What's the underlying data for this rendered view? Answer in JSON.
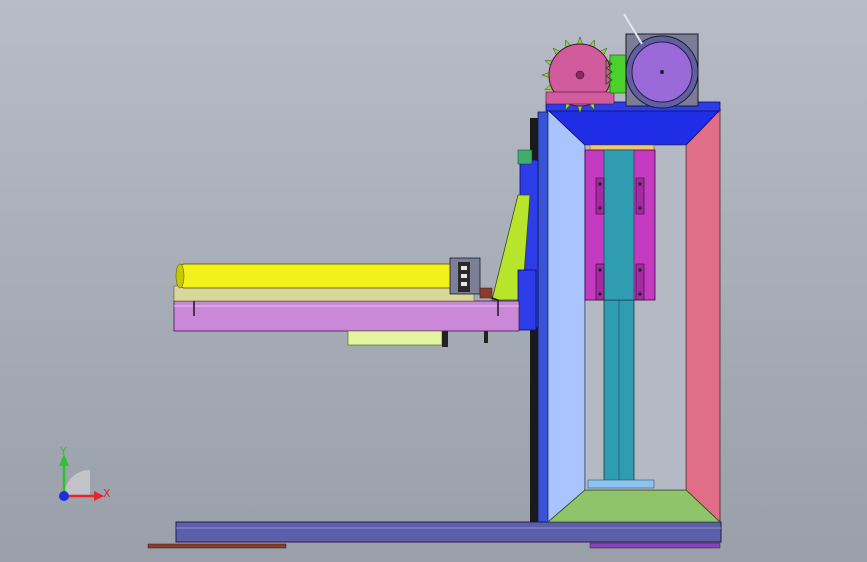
{
  "viewport": {
    "background_top": "#b7bcc6",
    "background_bottom": "#9aa0aa"
  },
  "triad": {
    "x_label": "X",
    "y_label": "Y",
    "x_color": "#e8242a",
    "y_color": "#2ec231",
    "z_color": "#1c2fe0"
  },
  "colors": {
    "base_rail": "#5b5ea8",
    "frame_light_blue": "#a9c4ff",
    "frame_pink": "#e06e86",
    "frame_green": "#8fc46a",
    "frame_top_blue": "#1f2ee6",
    "carriage_magenta": "#c43ac0",
    "column_teal": "#2f9cb1",
    "arm_lilac": "#cc88d8",
    "roller_yellow": "#f2f21a",
    "sprocket_pink": "#d05c9e",
    "motor_purple": "#9a6ad8",
    "bracket_lime": "#b8e52c",
    "pad_pale_yellow": "#e4f4a0",
    "side_plate_blue": "#3a52d4",
    "foot_brown": "#8a3b2a"
  }
}
